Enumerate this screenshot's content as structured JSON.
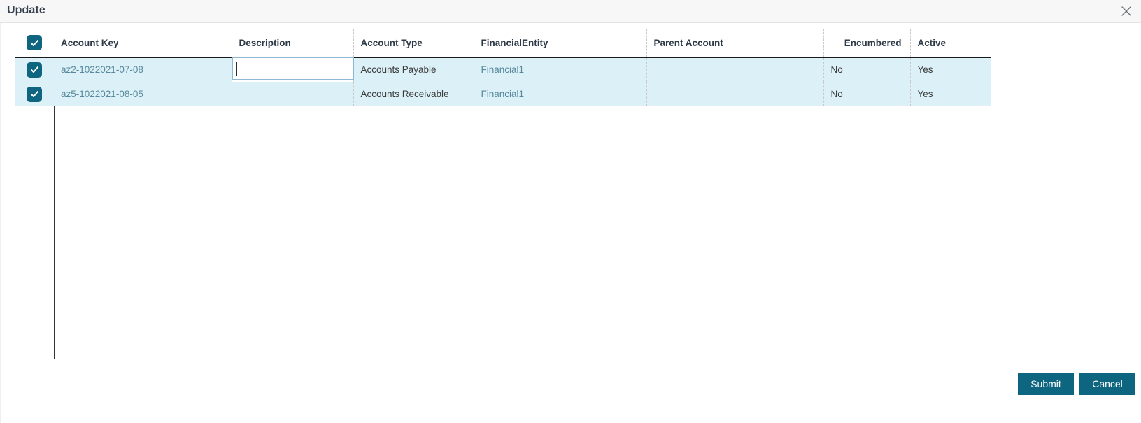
{
  "dialog": {
    "title": "Update",
    "close_icon": "close-icon"
  },
  "grid": {
    "header_checkbox_checked": true,
    "columns": [
      {
        "key": "checkbox",
        "label": "",
        "align": "left"
      },
      {
        "key": "account_key",
        "label": "Account Key",
        "align": "left"
      },
      {
        "key": "description",
        "label": "Description",
        "align": "left"
      },
      {
        "key": "account_type",
        "label": "Account Type",
        "align": "left"
      },
      {
        "key": "financial_entity",
        "label": "FinancialEntity",
        "align": "left"
      },
      {
        "key": "parent_account",
        "label": "Parent Account",
        "align": "left"
      },
      {
        "key": "encumbered",
        "label": "Encumbered",
        "align": "right"
      },
      {
        "key": "active",
        "label": "Active",
        "align": "left"
      }
    ],
    "rows": [
      {
        "checked": true,
        "account_key": "az2-1022021-07-08",
        "description": "",
        "description_editing": true,
        "account_type": "Accounts Payable",
        "financial_entity": "Financial1",
        "parent_account": "",
        "encumbered": "No",
        "active": "Yes"
      },
      {
        "checked": true,
        "account_key": "az5-1022021-08-05",
        "description": "",
        "description_editing": false,
        "account_type": "Accounts Receivable",
        "financial_entity": "Financial1",
        "parent_account": "",
        "encumbered": "No",
        "active": "Yes"
      }
    ],
    "description_editor": {
      "value": "",
      "placeholder": ""
    }
  },
  "footer": {
    "submit_label": "Submit",
    "cancel_label": "Cancel"
  },
  "colors": {
    "accent": "#0e6580",
    "row_selected_bg": "#dcf0f7",
    "link_text": "#57889c",
    "title_text": "#34404e",
    "header_text": "#2d3a47"
  }
}
